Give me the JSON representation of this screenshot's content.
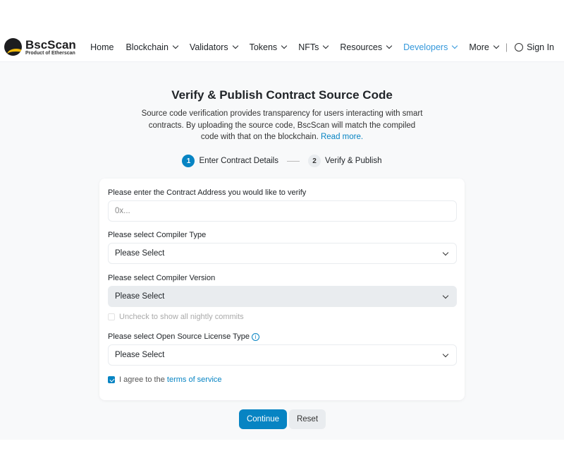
{
  "header": {
    "logo_name": "BscScan",
    "logo_sub": "Product of Etherscan",
    "nav": [
      {
        "label": "Home",
        "dropdown": false
      },
      {
        "label": "Blockchain",
        "dropdown": true
      },
      {
        "label": "Validators",
        "dropdown": true
      },
      {
        "label": "Tokens",
        "dropdown": true
      },
      {
        "label": "NFTs",
        "dropdown": true
      },
      {
        "label": "Resources",
        "dropdown": true
      },
      {
        "label": "Developers",
        "dropdown": true,
        "active": true
      },
      {
        "label": "More",
        "dropdown": true
      }
    ],
    "separator": "|",
    "sign_in": "Sign In"
  },
  "page": {
    "title": "Verify & Publish Contract Source Code",
    "description": "Source code verification provides transparency for users interacting with smart contracts. By uploading the source code, BscScan will match the compiled code with that on the blockchain.",
    "read_more": "Read more."
  },
  "steps": [
    {
      "num": "1",
      "label": "Enter Contract Details"
    },
    {
      "num": "2",
      "label": "Verify & Publish"
    }
  ],
  "form": {
    "address_label": "Please enter the Contract Address you would like to verify",
    "address_placeholder": "0x...",
    "compiler_type_label": "Please select Compiler Type",
    "compiler_type_value": "Please Select",
    "compiler_version_label": "Please select Compiler Version",
    "compiler_version_value": "Please Select",
    "nightly_label": "Uncheck to show all nightly commits",
    "nightly_checked": false,
    "license_label": "Please select Open Source License Type",
    "license_value": "Please Select",
    "info_icon": "i",
    "agree_prefix": "I agree to the ",
    "agree_link": "terms of service",
    "agree_checked": true
  },
  "buttons": {
    "continue": "Continue",
    "reset": "Reset"
  },
  "colors": {
    "accent": "#0784c3",
    "active_nav": "#3498db",
    "logo_yellow": "#f0b90b"
  }
}
